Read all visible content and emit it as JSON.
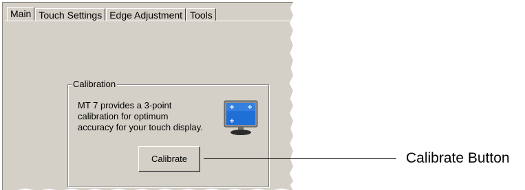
{
  "tabs": [
    {
      "label": "Main",
      "active": true
    },
    {
      "label": "Touch Settings",
      "active": false
    },
    {
      "label": "Edge Adjustment",
      "active": false
    },
    {
      "label": "Tools",
      "active": false
    }
  ],
  "calibration": {
    "group_title": "Calibration",
    "description_lines": [
      "MT 7 provides a 3-point",
      "calibration for optimum",
      "accuracy for your touch display."
    ],
    "button_label": "Calibrate",
    "icon": "monitor-calibration-icon"
  },
  "callout": {
    "label": "Calibrate Button"
  },
  "colors": {
    "panel_bg": "#d4d0c8",
    "monitor_screen": "#1f6fd6"
  }
}
